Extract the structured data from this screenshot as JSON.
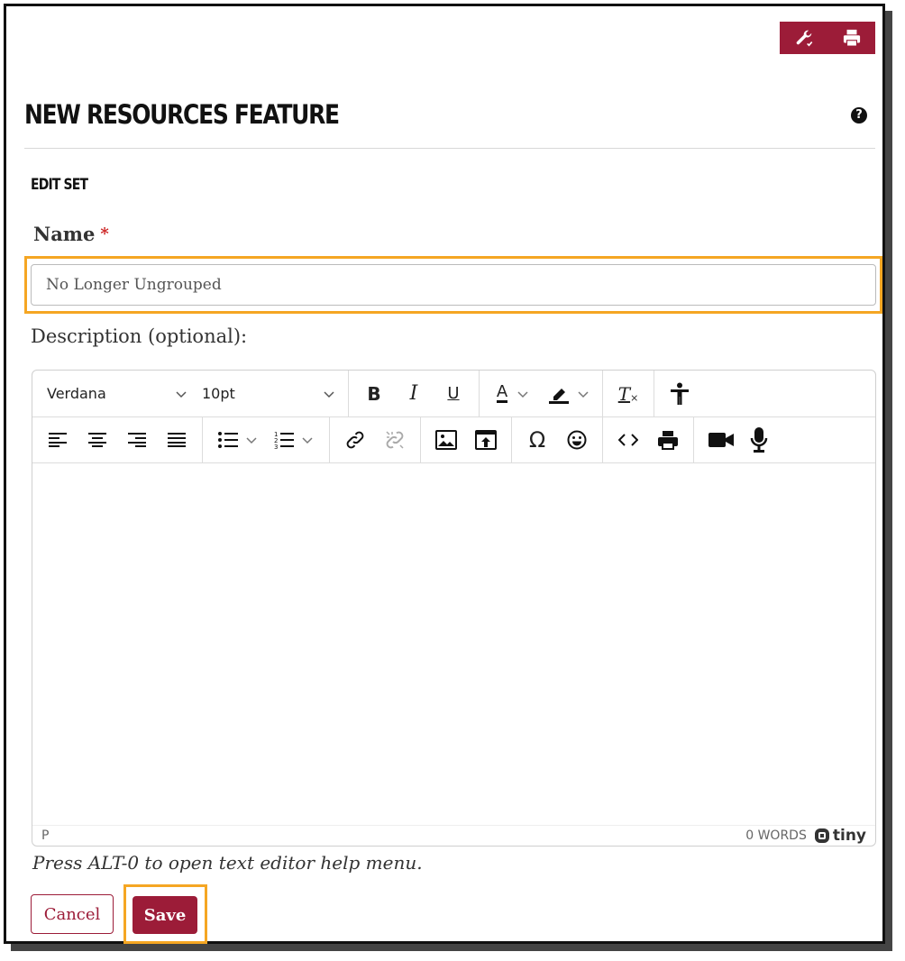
{
  "header": {
    "title": "NEW RESOURCES FEATURE",
    "help_icon_glyph": "?",
    "tool_buttons": [
      {
        "name": "settings",
        "icon": "wrench-icon"
      },
      {
        "name": "print",
        "icon": "printer-icon"
      }
    ]
  },
  "section": {
    "subtitle": "EDIT SET"
  },
  "form": {
    "name_label": "Name",
    "required_marker": "*",
    "name_value": "No Longer Ungrouped",
    "description_label": "Description (optional):"
  },
  "editor": {
    "font_family": "Verdana",
    "font_size": "10pt",
    "bold_label": "B",
    "italic_label": "I",
    "underline_label": "U",
    "font_color_label": "A",
    "clear_format_label": "T",
    "omega_label": "Ω",
    "status_path": "P",
    "word_count": "0 WORDS",
    "brand": "tiny"
  },
  "hint": "Press ALT-0 to open text editor help menu.",
  "actions": {
    "cancel_label": "Cancel",
    "save_label": "Save"
  },
  "colors": {
    "brand": "#9c1c38",
    "highlight": "#f5a623"
  }
}
